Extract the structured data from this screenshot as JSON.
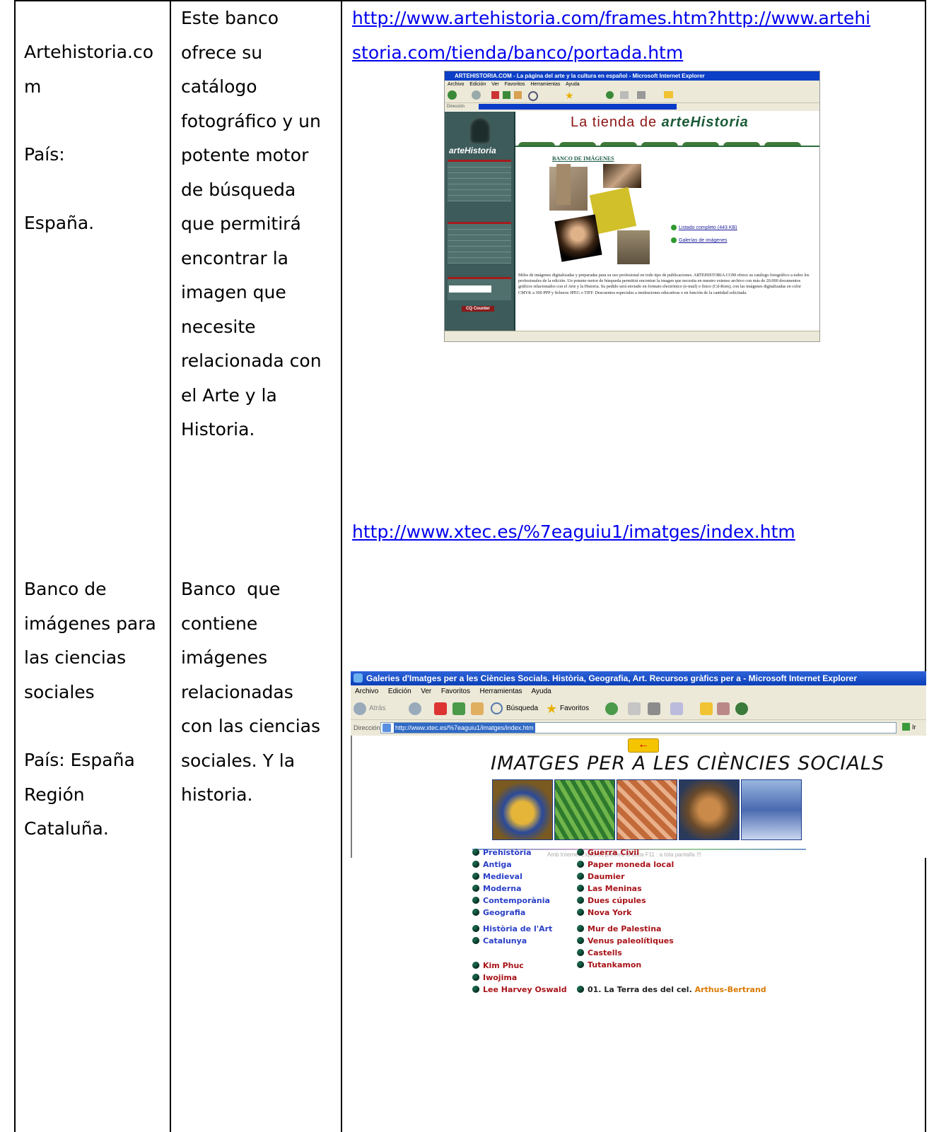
{
  "rows": [
    {
      "site": {
        "name_lines": [
          "Artehistoria.co",
          "m"
        ],
        "pais_label": "País:",
        "pais_value": "España."
      },
      "description": "Este banco ofrece su catálogo fotográfico y un potente motor de búsqueda que permitirá encontrar la imagen que necesite relacionada con el Arte y la Historia.",
      "description_lines": [
        "Este banco",
        "ofrece su",
        "catálogo",
        "fotográfico y un",
        "potente motor",
        "de búsqueda",
        "que permitirá",
        "encontrar la",
        "imagen que",
        "necesite",
        "relacionada con",
        "el Arte y la",
        "Historia."
      ],
      "link_lines": [
        "http://www.artehistoria.com/frames.htm?http://www.artehi",
        "storia.com/tienda/banco/portada.htm"
      ],
      "screenshot": {
        "window_title": "ARTEHISTORIA.COM - La página del arte y la cultura en español - Microsoft Internet Explorer",
        "menu": "Archivo Edición Ver Favoritos Herramientas Ayuda",
        "address_label": "Dirección",
        "brand": "arteHistoria",
        "header_prefix": "La tienda de ",
        "header_brand": "arteHistoria",
        "section": "BANCO DE IMÁGENES",
        "list": [
          "Listado completo (443 KB)",
          "Galerías de imágenes"
        ],
        "sidebar_button": "CQ Counter",
        "paragraph": "Miles de imágenes digitalizadas y preparadas para su uso profesional en todo tipo de publicaciones. ARTEHISTORIA.COM ofrece su catálogo fotográfico a todos los profesionales de la edición. Un potente motor de búsqueda permitirá encontrar la imagen que necesita en nuestro extenso archivo con más de 20.000 documentos gráficos relacionados con el Arte y la Historia. Su pedido será enviado en formato electrónico (e-mail) o físico (Cd-Rom), con las imágenes digitalizadas en color CMYK a 300 PPP y ficheros JPEG o TIFF. Descuentos especiales a instituciones educativas o en función de la cantidad solicitada."
      }
    },
    {
      "site": {
        "name_lines": [
          "Banco de",
          "imágenes para",
          "las ciencias",
          "sociales"
        ],
        "pais_line": "País: España",
        "region_lines": [
          "Región",
          "Cataluña."
        ]
      },
      "description_lines": [
        "Banco  que",
        "contiene",
        "imágenes",
        "relacionadas",
        "con las ciencias",
        "sociales. Y la",
        "historia."
      ],
      "link": "http://www.xtec.es/%7eaguiu1/imatges/index.htm",
      "screenshot": {
        "window_title": "Galeries d'Imatges per a les Ciències Socials. Història, Geografia, Art. Recursos gràfics per a - Microsoft Internet Explorer",
        "menu": "Archivo  Edición  Ver  Favoritos  Herramientas  Ayuda",
        "toolbar_back": "Atrás",
        "toolbar_search": "Búsqueda",
        "toolbar_favorites": "Favoritos",
        "address_label": "Dirección",
        "address_url": "http://www.xtec.es/%7eaguiu1/imatges/index.htm",
        "go_label": "Ir",
        "heading": "IMATGES PER A LES CIÈNCIES SOCIALS",
        "hint": "Amb Internet Explorer, premeu la tecla F11 : a tota pantalla !!!",
        "left_links": [
          "Prehistòria",
          "Antiga",
          "Medieval",
          "Moderna",
          "Contemporània",
          "Geografia",
          "Història de l'Art",
          "Catalunya"
        ],
        "lower_left_links": [
          "Kim Phuc",
          "Iwojima",
          "Lee Harvey Oswald"
        ],
        "right_links": [
          "Guerra Civil",
          "Paper moneda local",
          "Daumier",
          "Las Meninas",
          "Dues cúpules",
          "Nova York",
          "Mur de Palestina",
          "Venus paleolítiques",
          "Castells",
          "Tutankamon"
        ],
        "extra_item": "01. La Terra des del cel.",
        "extra_author": "Arthus-Bertrand"
      }
    }
  ]
}
